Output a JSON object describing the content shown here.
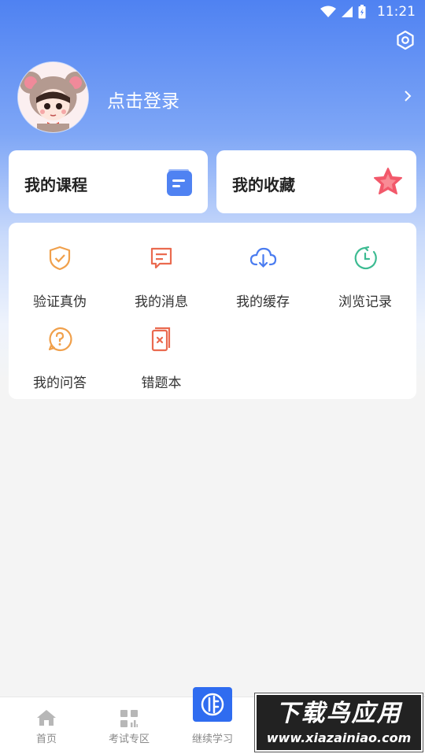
{
  "status_bar": {
    "time": "11:21"
  },
  "profile": {
    "login_label": "点击登录"
  },
  "cards": {
    "courses": {
      "label": "我的课程"
    },
    "favorites": {
      "label": "我的收藏"
    }
  },
  "features": [
    {
      "label": "验证真伪",
      "icon": "shield-check-icon",
      "color": "#f0a04b"
    },
    {
      "label": "我的消息",
      "icon": "message-icon",
      "color": "#ea6a4f"
    },
    {
      "label": "我的缓存",
      "icon": "cloud-download-icon",
      "color": "#4a7cf0"
    },
    {
      "label": "浏览记录",
      "icon": "clock-icon",
      "color": "#3dbb92"
    },
    {
      "label": "我的问答",
      "icon": "question-icon",
      "color": "#f0a04b"
    },
    {
      "label": "错题本",
      "icon": "wrong-book-icon",
      "color": "#ea6a4f"
    }
  ],
  "tabbar": {
    "items": [
      {
        "label": "首页"
      },
      {
        "label": "考试专区"
      },
      {
        "label": "继续学习"
      }
    ]
  },
  "watermark": {
    "title": "下载鸟应用",
    "url": "www.xiazainiao.com"
  },
  "colors": {
    "brand_blue": "#4f82f2",
    "card_bg": "#ffffff",
    "page_bg": "#f4f4f4"
  }
}
